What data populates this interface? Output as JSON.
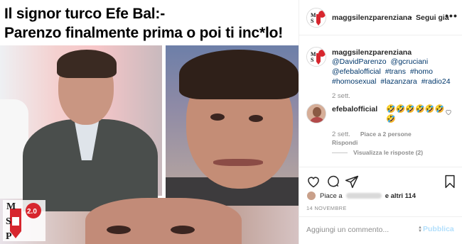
{
  "post_image": {
    "headline_line1": "Il signor turco Efe Bal:-",
    "headline_line2": "Parenzo finalmente prima o poi ti inc*lo!",
    "logo": {
      "top_letter": "M",
      "middle_letter": "S",
      "bottom_letter": "P",
      "badge": "2.0",
      "badge_color": "#d7262e"
    }
  },
  "header": {
    "username": "maggsilenzparenziana",
    "separator": "•",
    "follow_label": "Segui già",
    "more_label": "•••"
  },
  "caption": {
    "username": "maggsilenzparenziana",
    "tags": [
      "@DavidParenzo",
      "@gcruciani",
      "@efebalofficial",
      "#trans",
      "#homo",
      "#homosexual",
      "#lazanzara",
      "#radio24"
    ],
    "time": "2 sett."
  },
  "comment": {
    "username": "efebalofficial",
    "text": "🤣🤣🤣🤣🤣🤣🤣",
    "time": "2 sett.",
    "likes_label": "Piace a 2 persone",
    "reply_label": "Rispondi",
    "view_replies_label": "Visualizza le risposte (2)"
  },
  "likes": {
    "prefix": "Piace a",
    "suffix": "e altri 114"
  },
  "post_date": "14 NOVEMBRE",
  "add_comment": {
    "placeholder": "Aggiungi un commento...",
    "publish_label": "Pubblica"
  },
  "colors": {
    "link": "#00376b",
    "muted": "#8e8e8e",
    "publish_disabled": "#b2dffc",
    "emoji": "#f2b21c"
  }
}
